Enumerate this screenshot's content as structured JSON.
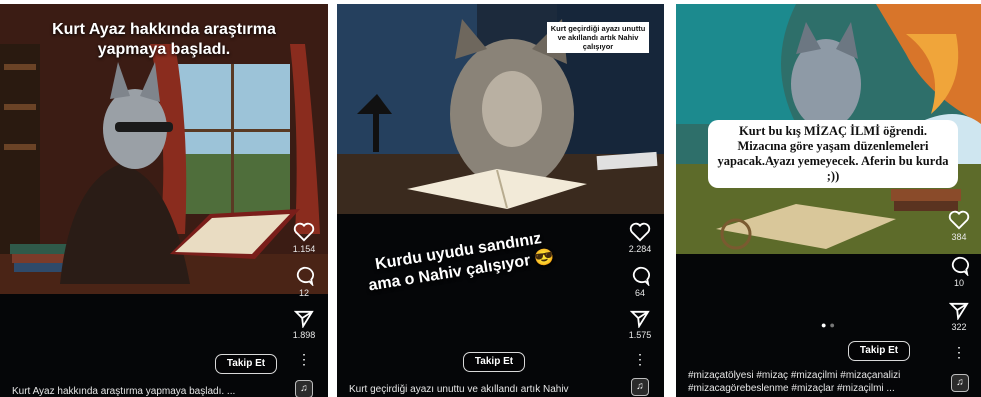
{
  "posts": [
    {
      "image_caption": "Kurt Ayaz hakkında araştırma yapmaya başladı.",
      "likes": "1.154",
      "comments": "12",
      "shares": "1.898",
      "follow_label": "Takip Et",
      "description": "Kurt Ayaz hakkında araştırma yapmaya başladı. ..."
    },
    {
      "image_caption": "Kurt geçirdiği ayazı unuttu ve akıllandı artık Nahiv çalışıyor",
      "overlay_text": "Kurdu uyudu sandınız ama o Nahiv çalışıyor 😎",
      "likes": "2.284",
      "comments": "64",
      "shares": "1.575",
      "follow_label": "Takip Et",
      "description": "Kurt geçirdiği ayazı unuttu ve akıllandı artık Nahiv"
    },
    {
      "image_caption": "Kurt bu kış MİZAÇ İLMİ öğrendi. Mizacına göre yaşam düzenlemeleri yapacak.Ayazı yemeyecek. Aferin bu kurda ;))",
      "likes": "384",
      "comments": "10",
      "shares": "322",
      "follow_label": "Takip Et",
      "description_line1": "#mizaçatölyesi #mizaç #mizaçilmi #mizaçanalizi",
      "description_line2": "#mizacagörebeslenme #mizaçlar #mizaçilmi ..."
    }
  ],
  "icons": {
    "like": "heart-icon",
    "comment": "comment-icon",
    "share": "send-icon",
    "more": "more-dots-icon",
    "audio": "music-icon"
  },
  "colors": {
    "background": "#050608",
    "text": "#ffffff"
  }
}
